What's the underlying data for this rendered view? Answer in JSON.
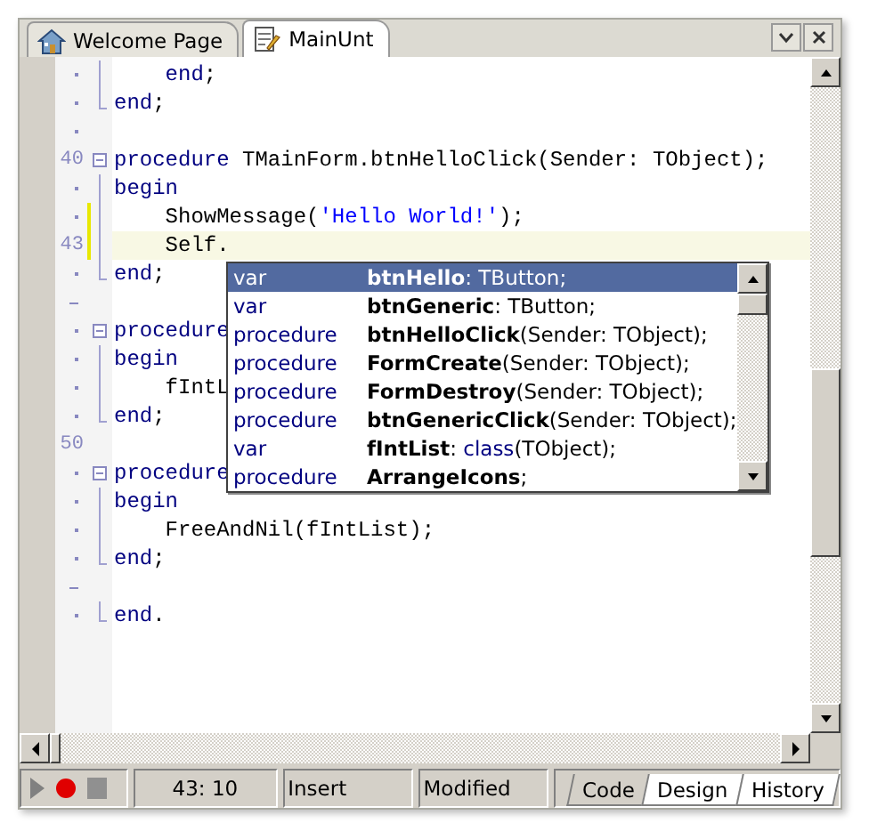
{
  "tabs": [
    {
      "label": "Welcome Page",
      "kind": "home",
      "selected": false
    },
    {
      "label": "MainUnt",
      "kind": "unit",
      "selected": true
    }
  ],
  "editor": {
    "lines": [
      {
        "kind": "dot",
        "fold": {
          "kind": "mid"
        },
        "changed": false,
        "current": false,
        "tokens": [
          {
            "text": "    end",
            "kind": "keyword"
          },
          {
            "text": ";",
            "kind": "plain"
          }
        ]
      },
      {
        "kind": "dot",
        "fold": {
          "kind": "end"
        },
        "changed": false,
        "current": false,
        "tokens": [
          {
            "text": "end",
            "kind": "keyword"
          },
          {
            "text": ";",
            "kind": "plain"
          }
        ]
      },
      {
        "kind": "dot",
        "changed": false,
        "current": false
      },
      {
        "kind": "number",
        "number": "40",
        "fold": {
          "kind": "start"
        },
        "changed": false,
        "current": false,
        "tokens": [
          {
            "text": "procedure",
            "kind": "keyword"
          },
          {
            "text": " TMainForm.btnHelloClick(Sender: TObject);",
            "kind": "plain"
          }
        ]
      },
      {
        "kind": "dot",
        "fold": {
          "kind": "mid"
        },
        "changed": false,
        "current": false,
        "tokens": [
          {
            "text": "begin",
            "kind": "keyword"
          }
        ]
      },
      {
        "kind": "dot",
        "fold": {
          "kind": "mid"
        },
        "changed": true,
        "current": false,
        "tokens": [
          {
            "text": "    ShowMessage(",
            "kind": "plain"
          },
          {
            "text": "'Hello World!'",
            "kind": "string"
          },
          {
            "text": ");",
            "kind": "plain"
          }
        ]
      },
      {
        "kind": "number",
        "number": "43",
        "fold": {
          "kind": "mid"
        },
        "changed": true,
        "current": true,
        "tokens": [
          {
            "text": "    Self.",
            "kind": "plain"
          }
        ]
      },
      {
        "kind": "dot",
        "fold": {
          "kind": "end"
        },
        "changed": false,
        "current": false,
        "tokens": [
          {
            "text": "end",
            "kind": "keyword"
          },
          {
            "text": ";",
            "kind": "plain"
          }
        ]
      },
      {
        "kind": "dash",
        "changed": false,
        "current": false
      },
      {
        "kind": "dot",
        "fold": {
          "kind": "start"
        },
        "changed": false,
        "current": false,
        "tokens": [
          {
            "text": "procedure",
            "kind": "keyword"
          }
        ]
      },
      {
        "kind": "dot",
        "fold": {
          "kind": "mid"
        },
        "changed": false,
        "current": false,
        "tokens": [
          {
            "text": "begin",
            "kind": "keyword"
          }
        ]
      },
      {
        "kind": "dot",
        "fold": {
          "kind": "mid"
        },
        "changed": false,
        "current": false,
        "tokens": [
          {
            "text": "    fIntL",
            "kind": "plain"
          }
        ]
      },
      {
        "kind": "dot",
        "fold": {
          "kind": "end"
        },
        "changed": false,
        "current": false,
        "tokens": [
          {
            "text": "end",
            "kind": "keyword"
          },
          {
            "text": ";",
            "kind": "plain"
          }
        ]
      },
      {
        "kind": "number",
        "number": "50",
        "changed": false,
        "current": false
      },
      {
        "kind": "dot",
        "fold": {
          "kind": "start"
        },
        "changed": false,
        "current": false,
        "tokens": [
          {
            "text": "procedure",
            "kind": "keyword"
          }
        ]
      },
      {
        "kind": "dot",
        "fold": {
          "kind": "mid"
        },
        "changed": false,
        "current": false,
        "tokens": [
          {
            "text": "begin",
            "kind": "keyword"
          }
        ]
      },
      {
        "kind": "dot",
        "fold": {
          "kind": "mid"
        },
        "changed": false,
        "current": false,
        "tokens": [
          {
            "text": "    FreeAndNil(fIntList);",
            "kind": "plain"
          }
        ]
      },
      {
        "kind": "dot",
        "fold": {
          "kind": "end"
        },
        "changed": false,
        "current": false,
        "tokens": [
          {
            "text": "end",
            "kind": "keyword"
          },
          {
            "text": ";",
            "kind": "plain"
          }
        ]
      },
      {
        "kind": "dash",
        "changed": false,
        "current": false
      },
      {
        "kind": "dot",
        "fold": {
          "kind": "end"
        },
        "changed": false,
        "current": false,
        "tokens": [
          {
            "text": "end",
            "kind": "keyword"
          },
          {
            "text": ".",
            "kind": "plain"
          }
        ]
      }
    ]
  },
  "completion": {
    "items": [
      {
        "category": "var",
        "name": "btnHello",
        "selected": true,
        "signature": [
          {
            "text": ": TButton;",
            "kind": "plain"
          }
        ]
      },
      {
        "category": "var",
        "name": "btnGeneric",
        "selected": false,
        "signature": [
          {
            "text": ": TButton;",
            "kind": "plain"
          }
        ]
      },
      {
        "category": "procedure",
        "name": "btnHelloClick",
        "selected": false,
        "signature": [
          {
            "text": "(Sender: TObject);",
            "kind": "plain"
          }
        ]
      },
      {
        "category": "procedure",
        "name": "FormCreate",
        "selected": false,
        "signature": [
          {
            "text": "(Sender: TObject);",
            "kind": "plain"
          }
        ]
      },
      {
        "category": "procedure",
        "name": "FormDestroy",
        "selected": false,
        "signature": [
          {
            "text": "(Sender: TObject);",
            "kind": "plain"
          }
        ]
      },
      {
        "category": "procedure",
        "name": "btnGenericClick",
        "selected": false,
        "signature": [
          {
            "text": "(Sender: TObject);",
            "kind": "plain"
          }
        ]
      },
      {
        "category": "var",
        "name": "fIntList",
        "selected": false,
        "signature": [
          {
            "text": ": ",
            "kind": "plain"
          },
          {
            "text": "class",
            "kind": "keyword"
          },
          {
            "text": "(TObject);",
            "kind": "plain"
          }
        ]
      },
      {
        "category": "procedure",
        "name": "ArrangeIcons",
        "selected": false,
        "signature": [
          {
            "text": ";",
            "kind": "plain"
          }
        ]
      }
    ]
  },
  "status_bar": {
    "position": "43: 10",
    "mode": "Insert",
    "state": "Modified",
    "view_tabs": [
      {
        "label": "Code",
        "selected": true
      },
      {
        "label": "Design",
        "selected": false
      },
      {
        "label": "History",
        "selected": false
      }
    ]
  }
}
